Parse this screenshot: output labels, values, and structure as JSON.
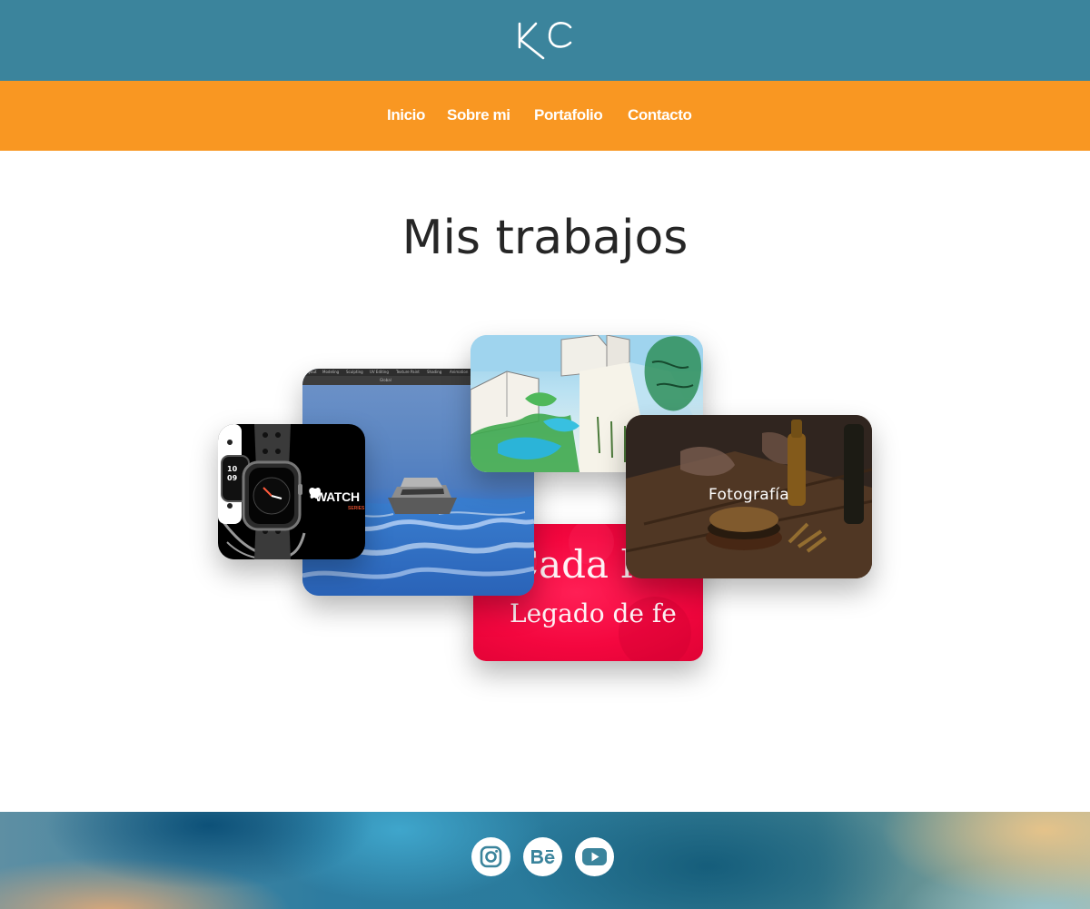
{
  "header": {
    "logo_text": "KC"
  },
  "nav": {
    "items": [
      {
        "label": "Inicio"
      },
      {
        "label": "Sobre mi"
      },
      {
        "label": "Portafolio"
      },
      {
        "label": "Contacto"
      }
    ]
  },
  "main": {
    "title": "Mis trabajos",
    "cards": {
      "watch": {
        "label": "WATCH",
        "sub": "SERIES"
      },
      "blender": {
        "tabs": [
          "Layout",
          "Modeling",
          "Sculpting",
          "UV Editing",
          "Texture Paint",
          "Shading",
          "Animation"
        ],
        "transform": "Global"
      },
      "red": {
        "line1": "Cada latido",
        "line2": "Legado de fe"
      },
      "photo": {
        "label": "Fotografía"
      }
    }
  },
  "footer": {
    "social": [
      {
        "icon": "instagram-icon"
      },
      {
        "icon": "behance-icon"
      },
      {
        "icon": "youtube-icon"
      }
    ]
  },
  "colors": {
    "header_bg": "#3b849c",
    "nav_bg": "#f99722",
    "title_text": "#262626",
    "red_card": "#f4073f"
  }
}
